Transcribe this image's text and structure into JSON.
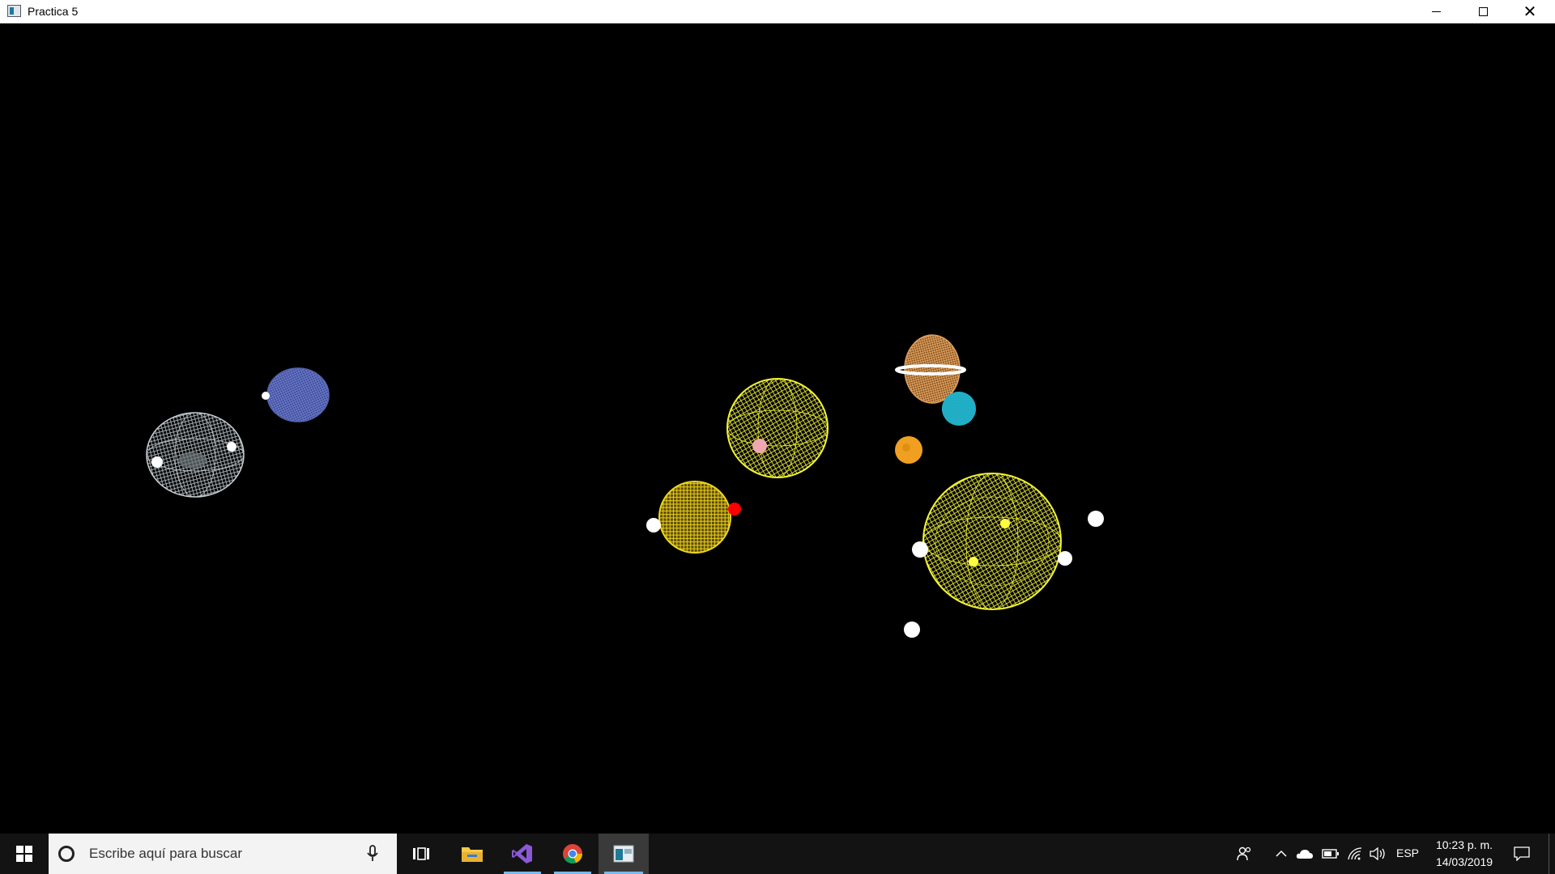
{
  "window": {
    "title": "Practica 5",
    "controls": [
      "minimize",
      "maximize",
      "close"
    ]
  },
  "scene": {
    "background": "#000000",
    "bodies": [
      {
        "name": "white-wireframe-planet",
        "color": "#c8d0d4",
        "style": "wireframe"
      },
      {
        "name": "blue-wireframe-planet",
        "color": "#5564b0",
        "style": "wireframe"
      },
      {
        "name": "yellow-wireframe-sphere-center",
        "color": "#f2f235",
        "style": "wireframe"
      },
      {
        "name": "yellow-wireframe-sphere-left",
        "color": "#ecd61e",
        "style": "wireframe"
      },
      {
        "name": "ringed-planet",
        "color": "#e0a05a",
        "style": "wireframe"
      },
      {
        "name": "cyan-planet",
        "color": "#23b4cc",
        "style": "wireframe"
      },
      {
        "name": "orange-planet",
        "color": "#f0a020",
        "style": "solid"
      },
      {
        "name": "large-yellow-wireframe-sphere",
        "color": "#f2f235",
        "style": "wireframe"
      },
      {
        "name": "pink-moon",
        "color": "#f0a8b0",
        "style": "solid"
      },
      {
        "name": "red-moon",
        "color": "#ff0000",
        "style": "solid"
      },
      {
        "name": "white-moons",
        "color": "#ffffff",
        "style": "solid"
      }
    ]
  },
  "taskbar": {
    "search_placeholder": "Escribe aquí para buscar",
    "apps": [
      "task-view",
      "file-explorer",
      "visual-studio",
      "google-chrome",
      "practica-5"
    ],
    "active_app": "practica-5",
    "tray": {
      "language": "ESP",
      "time": "10:23 p. m.",
      "date": "14/03/2019"
    },
    "accent_color": "#76b9ed"
  }
}
